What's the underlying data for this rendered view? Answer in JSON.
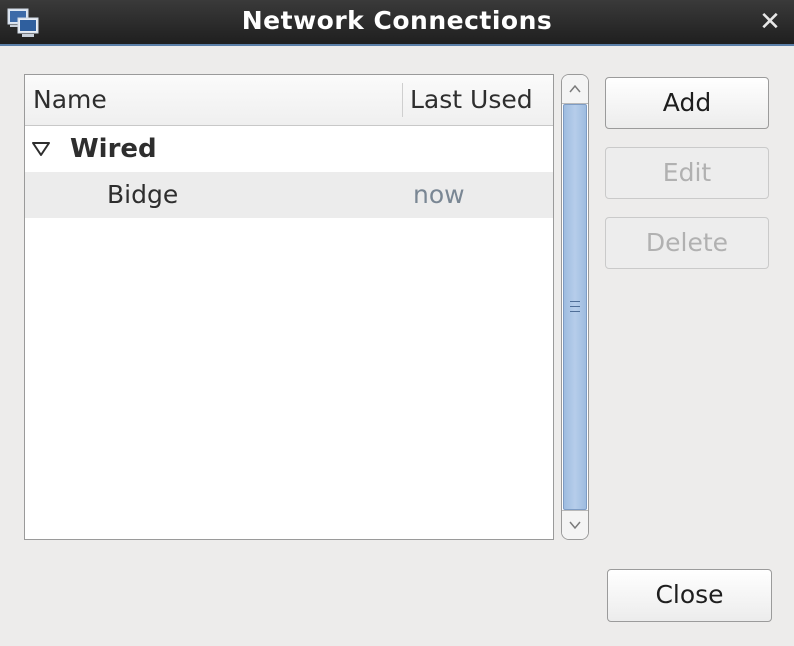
{
  "window": {
    "title": "Network Connections"
  },
  "columns": {
    "name": "Name",
    "last_used": "Last Used"
  },
  "groups": [
    {
      "label": "Wired",
      "expanded": true,
      "connections": [
        {
          "name": "Bidge",
          "last_used": "now",
          "selected": true
        }
      ]
    }
  ],
  "buttons": {
    "add": {
      "label": "Add",
      "enabled": true
    },
    "edit": {
      "label": "Edit",
      "enabled": false
    },
    "delete": {
      "label": "Delete",
      "enabled": false
    },
    "close": {
      "label": "Close",
      "enabled": true
    }
  },
  "icons": {
    "window": "network-connections-icon",
    "close": "close-icon",
    "expander": "triangle-down-icon",
    "scroll_up": "chevron-up-icon",
    "scroll_down": "chevron-down-icon",
    "grip": "scroll-grip-icon"
  },
  "colors": {
    "titlebar": "#2a2a2a",
    "titlebar_text": "#ffffff",
    "window_bg": "#edeceb",
    "selected_row": "#ececec",
    "scroll_thumb": "#a9c4e6",
    "muted_text": "#7a8794"
  }
}
